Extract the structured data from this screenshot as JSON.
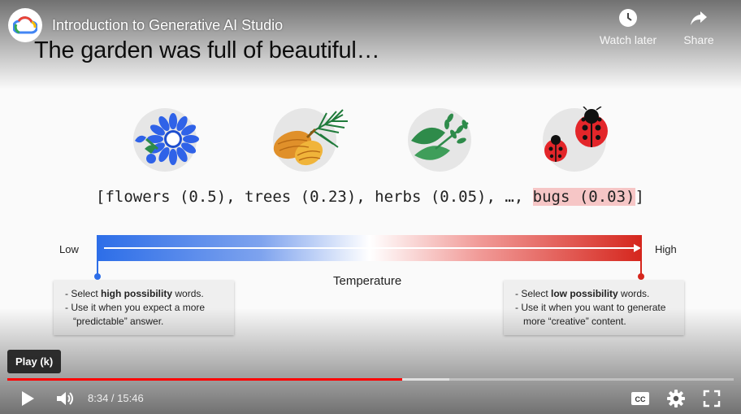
{
  "player": {
    "title": "Introduction to Generative AI Studio",
    "watch_later_label": "Watch later",
    "share_label": "Share"
  },
  "slide": {
    "heading": "The garden was full of beautiful…",
    "icons": [
      "flower-icon",
      "pinecone-icon",
      "herbs-icon",
      "ladybug-icon"
    ],
    "probability_list": {
      "open": "[",
      "items_text": "flowers (0.5), trees (0.23), herbs (0.05), …, ",
      "highlighted": "bugs (0.03)",
      "close": "]"
    },
    "temperature": {
      "low_label": "Low",
      "high_label": "High",
      "label": "Temperature",
      "colors": {
        "low": "#2d6ee8",
        "high": "#d5261d"
      }
    },
    "low_note": {
      "line1_prefix": "- Select ",
      "line1_bold": "high possibility",
      "line1_suffix": " words.",
      "line2": "- Use it when you expect a more",
      "line3": "“predictable” answer."
    },
    "high_note": {
      "line1_prefix": "- Select ",
      "line1_bold": "low possibility",
      "line1_suffix": " words.",
      "line2": "- Use it when you want to generate",
      "line3": "more “creative” content."
    }
  },
  "controls": {
    "tooltip": "Play (k)",
    "current_time": "8:34",
    "duration": "15:46",
    "time_display": "8:34 / 15:46",
    "played_fraction": 0.544,
    "buffered_fraction": 0.609,
    "accent_color": "#ff0000"
  }
}
